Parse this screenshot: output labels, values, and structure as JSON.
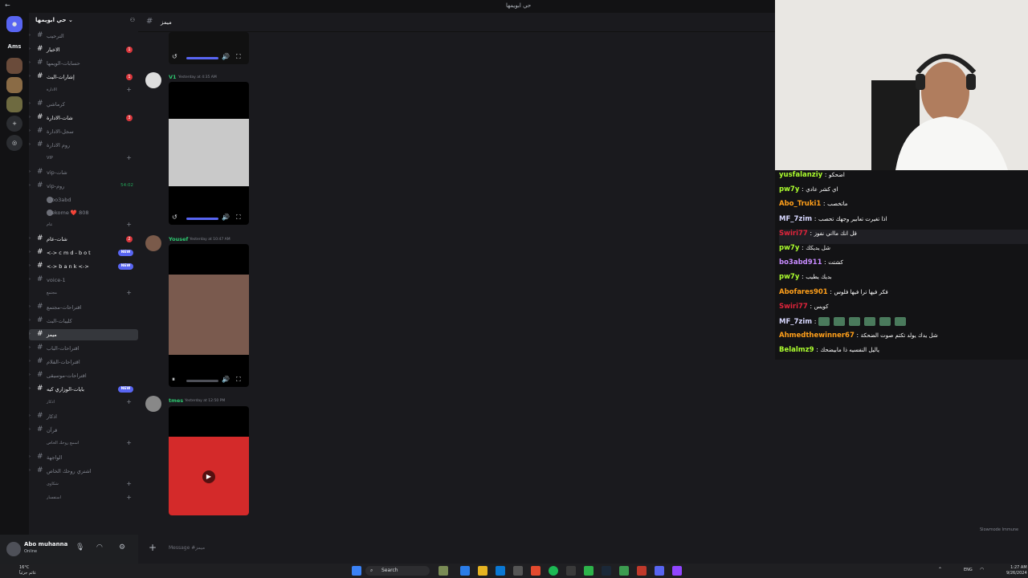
{
  "window": {
    "title": "حي ابويمها"
  },
  "server": {
    "name": "حي ابويمها"
  },
  "channels": [
    {
      "name": "الترحيب",
      "unread": false
    },
    {
      "name": "الاخبار",
      "badge": "1"
    },
    {
      "name": "حسابات-الويمها"
    },
    {
      "name": "إشارات-البث",
      "badge": "1"
    },
    {
      "category": "الادارة"
    },
    {
      "name": "كرماشي"
    },
    {
      "name": "شات-الادارة",
      "badge": "3"
    },
    {
      "name": "سجل-الادارة"
    },
    {
      "name": "روم الادارة"
    },
    {
      "category": "VIP"
    },
    {
      "name": "vip-شات"
    },
    {
      "name": "vip-روم",
      "timer": "54:02"
    },
    {
      "voice_user": "bo3abd"
    },
    {
      "voice_user": "ekome ❤️ 808"
    },
    {
      "category": "عام"
    },
    {
      "name": "شات-عام",
      "badge": "2"
    },
    {
      "name": "<-> c m d - b o t",
      "new": "NEW"
    },
    {
      "name": "<-> b a n k <->",
      "new": "NEW"
    },
    {
      "name": "voice-1"
    },
    {
      "category": "مجتمع"
    },
    {
      "name": "اقتراحات-مجتمع"
    },
    {
      "name": "كليبات-البث"
    },
    {
      "name": "ميمز",
      "selected": true
    },
    {
      "name": "اقتراحات-الباب"
    },
    {
      "name": "اقتراحات-الفلام"
    },
    {
      "name": "اقتراحات-موسيقى"
    },
    {
      "name": "بايات-الوزاري كيه",
      "new": "NEW"
    },
    {
      "category": "اذكار"
    },
    {
      "name": "اذكار"
    },
    {
      "name": "قرآن"
    },
    {
      "category": "اسمع روحك الخاص"
    },
    {
      "name": "الواجهة"
    },
    {
      "name": "اشتري روحك الخاص"
    },
    {
      "category": "شكاوى"
    },
    {
      "category": "استفسار"
    }
  ],
  "user": {
    "name": "Abo muhanna",
    "status": "Online"
  },
  "chat": {
    "channel": "ميمز",
    "input_placeholder": "Message #ميمز",
    "messages": [
      {
        "author": "V1",
        "color": "#2dc770",
        "time": "Yesterday at 4:35 AM"
      },
      {
        "author": "Yousef",
        "color": "#2dc770",
        "time": "Yesterday at 10:47 AM"
      },
      {
        "author": "tmes",
        "color": "#2dc770",
        "time": "Yesterday at 12:50 PM"
      }
    ]
  },
  "stream_chat": [
    {
      "user": "yusfalanziy",
      "color": "#adff2f",
      "text": "اضحكو"
    },
    {
      "user": "pw7y",
      "color": "#adff2f",
      "text": "اي كشر عادي"
    },
    {
      "user": "Abo_Truki1",
      "color": "#ff9f1a",
      "text": "ماتخصب"
    },
    {
      "user": "MF_7zim",
      "color": "#d8d8ff",
      "text": "اذا تغيرت تعابير وجهك تحصب"
    },
    {
      "user": "Swiri77",
      "color": "#e0243b",
      "text": "قل انك مااني نفوز"
    },
    {
      "user": "pw7y",
      "color": "#adff2f",
      "text": "شل يديكك"
    },
    {
      "user": "bo3abd911",
      "color": "#c78bff",
      "text": "كشتت"
    },
    {
      "user": "pw7y",
      "color": "#adff2f",
      "text": "بديك يطيب"
    },
    {
      "user": "Abofares901",
      "color": "#ff9f1a",
      "text": "فكر فيها ترا فيها فلوس"
    },
    {
      "user": "Swiri77",
      "color": "#e0243b",
      "text": "كويس"
    },
    {
      "user": "MF_7zim",
      "color": "#d8d8ff",
      "text": ""
    },
    {
      "user": "Ahmedthewinner67",
      "color": "#ff9f1a",
      "text": "شل يدك يولد تكتم صوت الضحكة"
    },
    {
      "user": "Belalmz9",
      "color": "#adff2f",
      "text": "ياليل النفسيه ذا مابيضحك"
    }
  ],
  "stream_chat_sep": ":",
  "slowmode": "Slowmode Immune",
  "taskbar": {
    "search": "Search",
    "weather_temp": "16°C",
    "weather_desc": "غائم جزئياً",
    "lang": "ENG",
    "time": "1:27 AM",
    "date": "9/26/2024"
  }
}
